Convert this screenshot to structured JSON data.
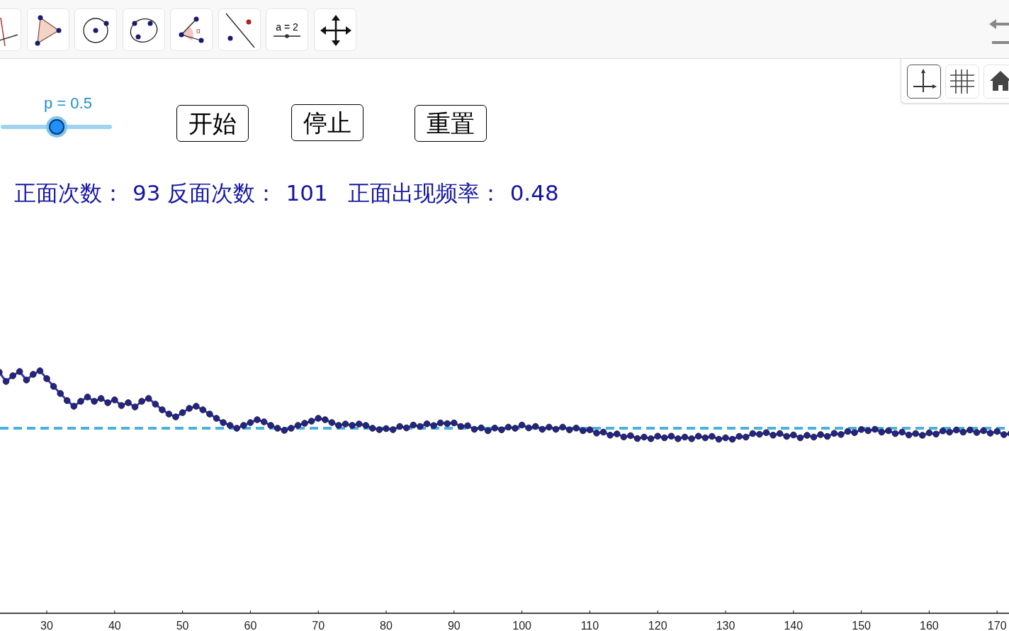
{
  "toolbar": {
    "tools": [
      {
        "kind": "line"
      },
      {
        "kind": "polygon"
      },
      {
        "kind": "circle"
      },
      {
        "kind": "conic"
      },
      {
        "kind": "angle",
        "symbol": "α"
      },
      {
        "kind": "reflect"
      },
      {
        "kind": "slider",
        "label": "a = 2"
      },
      {
        "kind": "move"
      }
    ]
  },
  "style_bar": {
    "buttons": [
      {
        "kind": "axes",
        "selected": true
      },
      {
        "kind": "grid",
        "selected": false
      },
      {
        "kind": "home",
        "selected": false
      }
    ]
  },
  "slider": {
    "label": "p = 0.5",
    "level": 0.5
  },
  "buttons": [
    "开始",
    "停止",
    "重置"
  ],
  "stats": [
    {
      "label": "正面次数：",
      "value": "93"
    },
    {
      "label": "反面次数：",
      "value": "101"
    },
    {
      "label": "正面出现频率：",
      "value": "0.48"
    }
  ],
  "x_axis": {
    "tick_labels": [
      "30",
      "40",
      "50",
      "60",
      "70",
      "80",
      "90",
      "100",
      "110",
      "120",
      "130",
      "140",
      "150",
      "160",
      "170"
    ]
  }
}
